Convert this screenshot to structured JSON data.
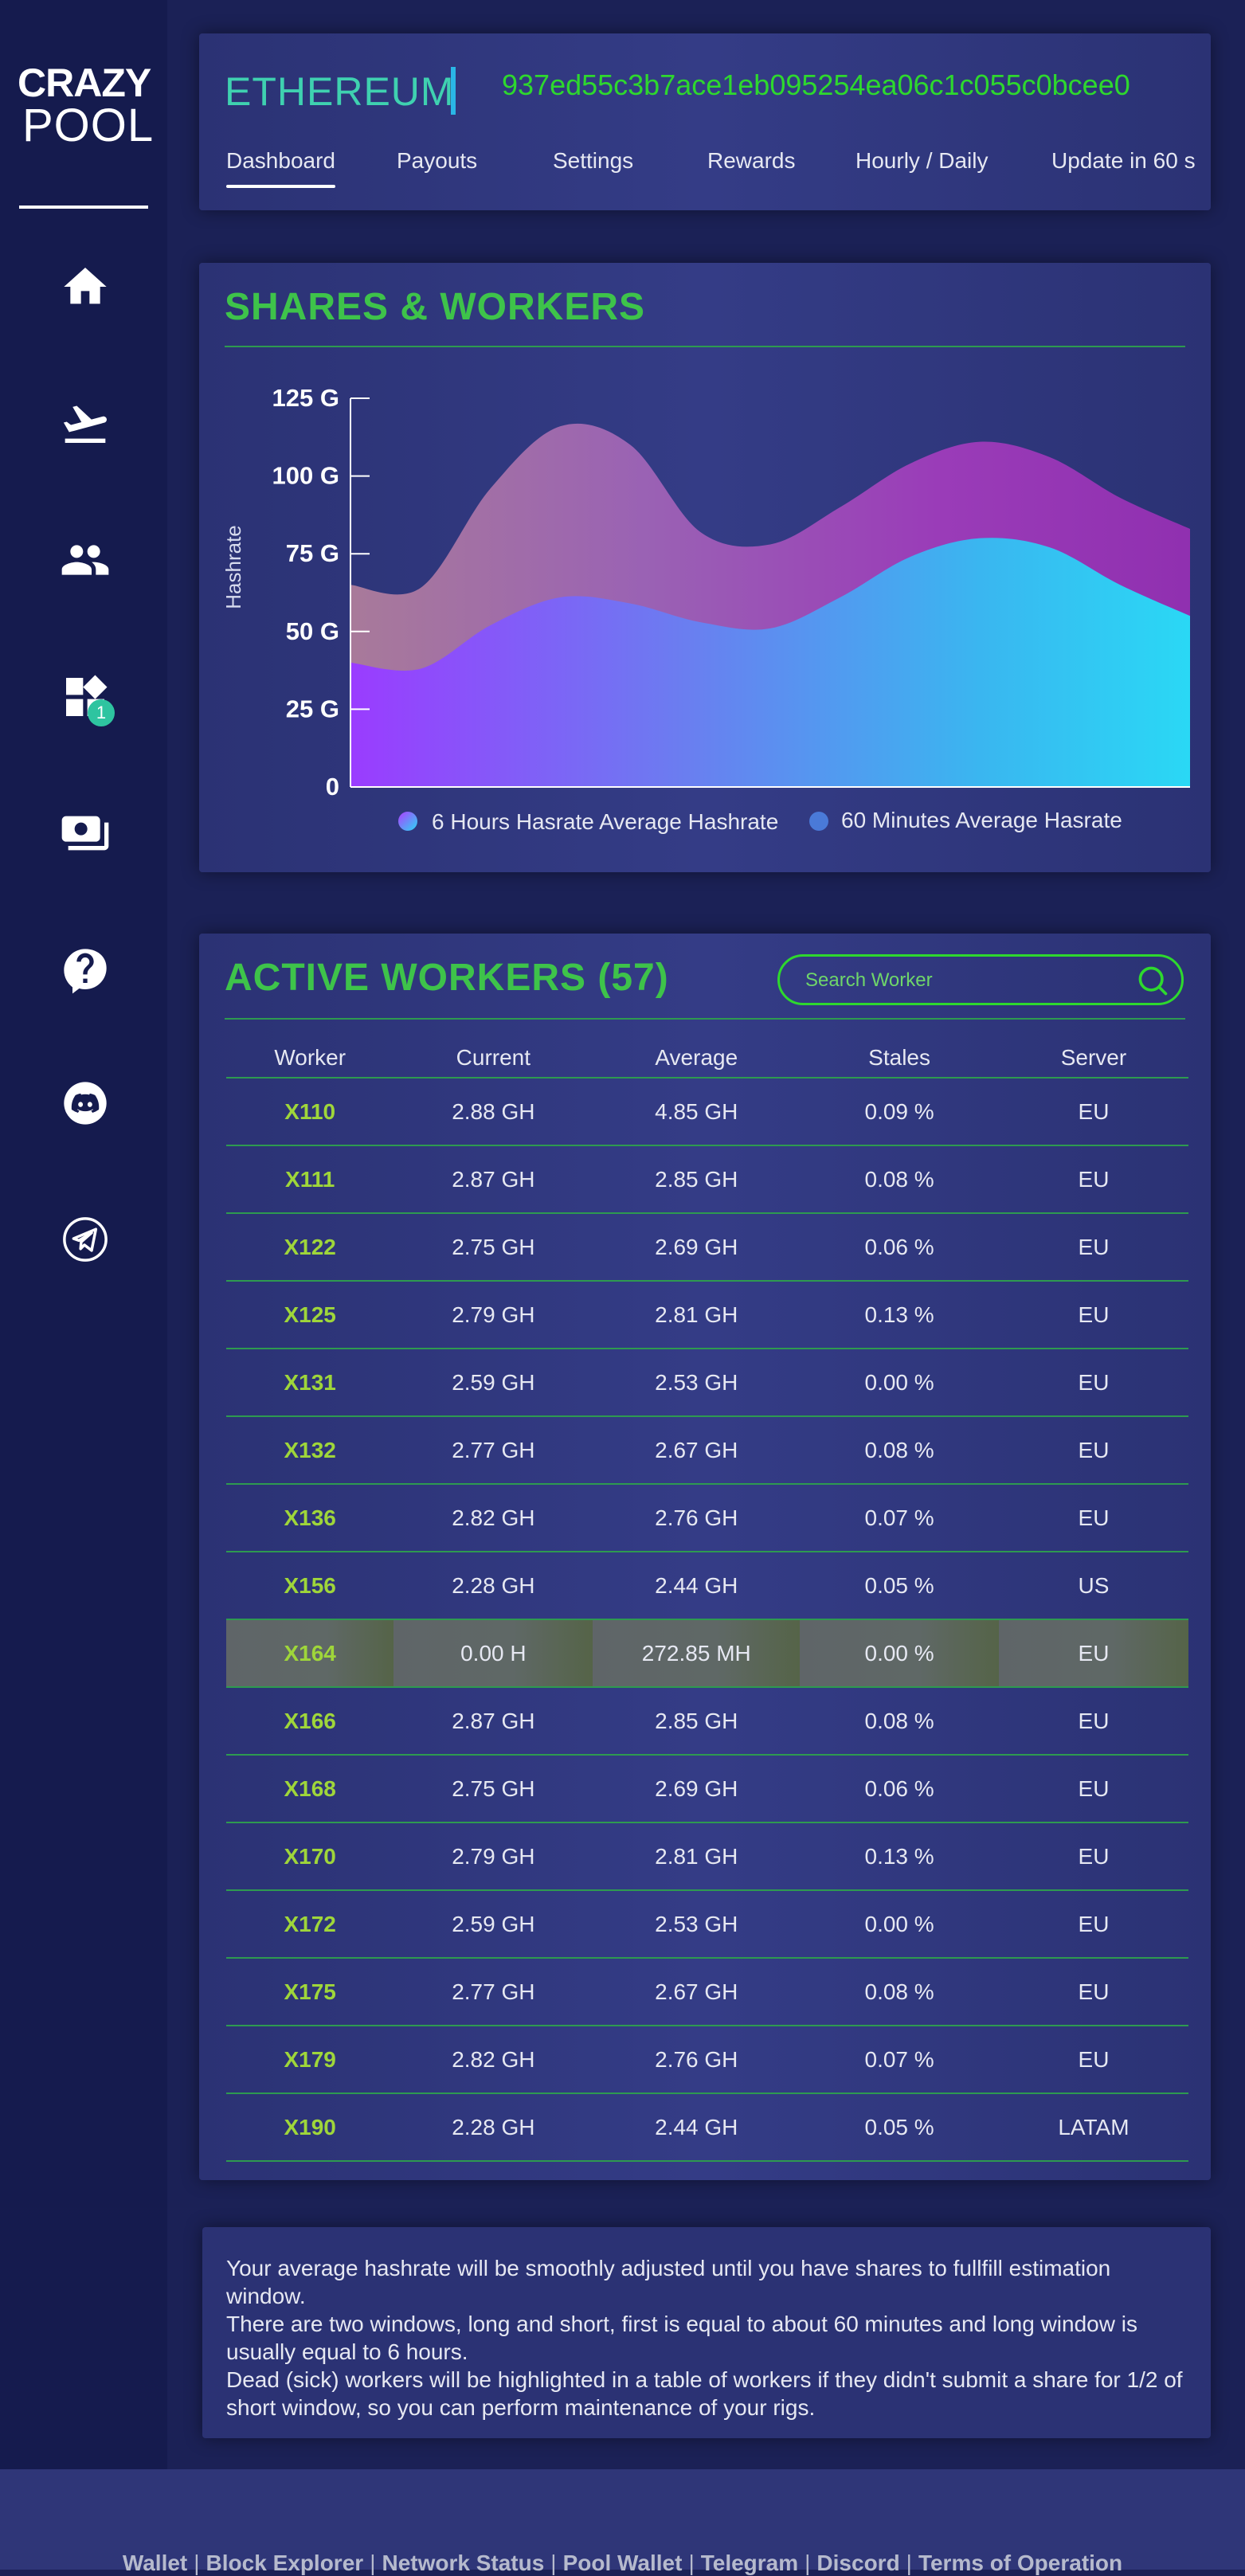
{
  "logo": {
    "line1": "CRAZY",
    "line2": "POOL"
  },
  "sidebar": {
    "items": [
      {
        "icon": "home-icon"
      },
      {
        "icon": "payouts-plane-icon"
      },
      {
        "icon": "workers-group-icon"
      },
      {
        "icon": "widgets-icon",
        "badge": "1"
      },
      {
        "icon": "wallet-icon"
      },
      {
        "icon": "help-icon"
      },
      {
        "icon": "discord-icon"
      },
      {
        "icon": "telegram-icon"
      }
    ]
  },
  "header": {
    "coin": "ETHEREUM",
    "address": "937ed55c3b7ace1eb095254ea06c1c055c0bcee0",
    "tabs": [
      "Dashboard",
      "Payouts",
      "Settings",
      "Rewards",
      "Hourly / Daily",
      "Update in 60 s"
    ],
    "active_tab": "Dashboard"
  },
  "shares": {
    "title": "SHARES & WORKERS",
    "ylabel": "Hashrate",
    "legend": [
      "6 Hours Hasrate Average Hashrate",
      "60 Minutes Average  Hasrate"
    ]
  },
  "chart_data": {
    "type": "area",
    "ylabel": "Hashrate",
    "yticks": [
      "0",
      "25 G",
      "50 G",
      "75 G",
      "100 G",
      "125 G"
    ],
    "ylim": [
      0,
      125
    ],
    "x": [
      0,
      1,
      2,
      3,
      4,
      5,
      6,
      7,
      8,
      9,
      10,
      11,
      12
    ],
    "series": [
      {
        "name": "6 Hours Hasrate Average Hashrate",
        "values": [
          65,
          64,
          96,
          116,
          110,
          82,
          78,
          90,
          104,
          111,
          106,
          93,
          83
        ]
      },
      {
        "name": "60 Minutes Average  Hasrate",
        "values": [
          40,
          38,
          52,
          61,
          59,
          53,
          51,
          61,
          74,
          80,
          77,
          65,
          55
        ]
      }
    ],
    "colors": {
      "top_area": "#9b3bc2",
      "bottom_area_start": "#9a3cff",
      "bottom_area_end": "#2ad8f5"
    },
    "grid": false,
    "legend_position": "bottom"
  },
  "workers": {
    "title": "ACTIVE WORKERS (57)",
    "search_placeholder": "Search Worker",
    "columns": [
      "Worker",
      "Current",
      "Average",
      "Stales",
      "Server"
    ],
    "rows": [
      [
        "X110",
        "2.88 GH",
        "4.85 GH",
        "0.09 %",
        "EU"
      ],
      [
        "X111",
        "2.87 GH",
        "2.85 GH",
        "0.08 %",
        "EU"
      ],
      [
        "X122",
        "2.75 GH",
        "2.69 GH",
        "0.06 %",
        "EU"
      ],
      [
        "X125",
        "2.79 GH",
        "2.81 GH",
        "0.13 %",
        "EU"
      ],
      [
        "X131",
        "2.59 GH",
        "2.53 GH",
        "0.00 %",
        "EU"
      ],
      [
        "X132",
        "2.77 GH",
        "2.67 GH",
        "0.08 %",
        "EU"
      ],
      [
        "X136",
        "2.82 GH",
        "2.76 GH",
        "0.07 %",
        "EU"
      ],
      [
        "X156",
        "2.28 GH",
        "2.44 GH",
        "0.05 %",
        "US"
      ],
      [
        "X164",
        "0.00 H",
        "272.85 MH",
        "0.00 %",
        "EU"
      ],
      [
        "X166",
        "2.87 GH",
        "2.85 GH",
        "0.08 %",
        "EU"
      ],
      [
        "X168",
        "2.75 GH",
        "2.69 GH",
        "0.06 %",
        "EU"
      ],
      [
        "X170",
        "2.79 GH",
        "2.81 GH",
        "0.13 %",
        "EU"
      ],
      [
        "X172",
        "2.59 GH",
        "2.53 GH",
        "0.00 %",
        "EU"
      ],
      [
        "X175",
        "2.77 GH",
        "2.67 GH",
        "0.08 %",
        "EU"
      ],
      [
        "X179",
        "2.82 GH",
        "2.76 GH",
        "0.07 %",
        "EU"
      ],
      [
        "X190",
        "2.28 GH",
        "2.44 GH",
        "0.05 %",
        "LATAM"
      ]
    ],
    "dead_worker": "X164"
  },
  "info": {
    "text": "Your average hashrate will be smoothly adjusted until you have shares to fullfill estimation window.\nThere are two windows, long and short, first is equal to about 60 minutes and long window is usually equal to 6 hours.\nDead (sick) workers will be highlighted in a table of workers if they didn't submit a share for 1/2 of short window, so you can perform maintenance of your rigs."
  },
  "footer": {
    "links": [
      "Wallet",
      "Block Explorer",
      "Network Status",
      "Pool Wallet",
      "Telegram",
      "Discord",
      "Terms of Operation"
    ]
  }
}
